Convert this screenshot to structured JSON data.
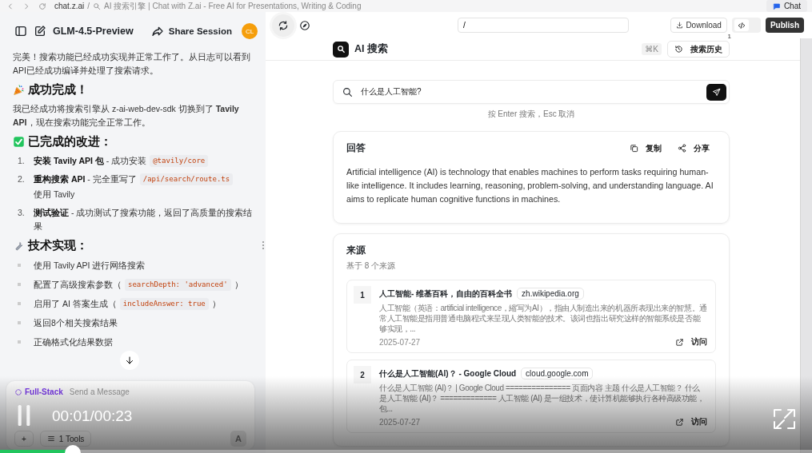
{
  "browser": {
    "site": "chat.z.ai",
    "separator": "/",
    "page_title": "AI 搜索引擎 | Chat with Z.ai - Free AI for Presentations, Writing & Coding",
    "chat_button": "Chat"
  },
  "chat_header": {
    "model": "GLM-4.5-Preview",
    "share": "Share Session",
    "avatar": "CL"
  },
  "message": [
    {
      "kind": "paragraph",
      "text": "完美！搜索功能已经成功实现并正常工作了。从日志可以看到API已经成功编译并处理了搜索请求。"
    },
    {
      "kind": "heading",
      "text": "成功完成！"
    },
    {
      "kind": "paragraph",
      "text": "我已经成功将搜索引擎从 z-ai-web-dev-sdk 切换到了 **Tavily API**，现在搜索功能完全正常工作。"
    },
    {
      "kind": "heading",
      "text": "已完成的改进："
    },
    {
      "kind": "ordered",
      "items": [
        {
          "number": "1.",
          "parts": [
            {
              "kind": "text",
              "text": "**安装 Tavily API 包** - 成功安装"
            },
            {
              "kind": "code",
              "text": "@tavily/core"
            }
          ]
        },
        {
          "number": "2.",
          "parts": [
            {
              "kind": "text",
              "text": "**重构搜索 API** - 完全重写了"
            },
            {
              "kind": "code",
              "text": "/api/search/route.ts"
            },
            {
              "kind": "text",
              "text": "使用 Tavily"
            }
          ]
        },
        {
          "number": "3.",
          "parts": [
            {
              "kind": "text",
              "text": "**测试验证** - 成功测试了搜索功能，返回了高质量的搜索结果"
            }
          ]
        }
      ]
    },
    {
      "kind": "heading",
      "text": "技术实现："
    },
    {
      "kind": "bullets",
      "items": [
        {
          "parts": [
            {
              "kind": "text",
              "text": "使用 Tavily API 进行网络搜索"
            }
          ]
        },
        {
          "parts": [
            {
              "kind": "text",
              "text": "配置了高级搜索参数（"
            },
            {
              "kind": "code",
              "text": "searchDepth: 'advanced'"
            },
            {
              "kind": "text",
              "text": "）"
            }
          ]
        },
        {
          "parts": [
            {
              "kind": "text",
              "text": "启用了 AI 答案生成（"
            },
            {
              "kind": "code",
              "text": "includeAnswer: true"
            },
            {
              "kind": "text",
              "text": "）"
            }
          ]
        },
        {
          "parts": [
            {
              "kind": "text",
              "text": "返回8个相关搜索结果"
            }
          ]
        },
        {
          "parts": [
            {
              "kind": "text",
              "text": "正确格式化结果数据"
            }
          ]
        }
      ]
    }
  ],
  "composer": {
    "mode": "Full-Stack",
    "placeholder": "Send a Message",
    "plus": "+",
    "tools": "1 Tools",
    "submit": "A"
  },
  "toolbar": {
    "address": "/",
    "download": "Download",
    "code_view_on": false,
    "publish": "Publish"
  },
  "app": {
    "title": "AI 搜索",
    "shortcut": "⌘K",
    "history": "搜索历史",
    "history_badge": "1",
    "query": "什么是人工智能?",
    "hint": "按 Enter 搜索，Esc 取消",
    "answer": {
      "title": "回答",
      "copy": "复制",
      "share": "分享",
      "text": "Artificial intelligence (AI) is technology that enables machines to perform tasks requiring human-like intelligence. It includes learning, reasoning, problem-solving, and understanding language. AI aims to replicate human cognitive functions in machines."
    },
    "sources": {
      "title": "来源",
      "subtitle": "基于 8 个来源",
      "items": [
        {
          "number": "1",
          "title": "人工智能- 维基百科，自由的百科全书",
          "domain": "zh.wikipedia.org",
          "snippet": "人工智能（英语：artificial intelligence，縮写为AI），指由人制造出来的机器所表现出来的智慧。通常人工智能是指用普通电脑程式来呈现人类智能的技术。该词也指出研究这样的智能系统是否能够实现，...",
          "date": "2025-07-27",
          "visit": "访问"
        },
        {
          "number": "2",
          "title": "什么是人工智能(AI)？ - Google Cloud",
          "domain": "cloud.google.com",
          "snippet": "什么是人工智能 (AI)？ | Google Cloud =============== 页面内容 主题 什么是人工智能？ 什么是人工智能 (AI)？ ============= 人工智能 (AI) 是一组技术，使计算机能够执行各种高级功能，包...",
          "date": "2025-07-27",
          "visit": "访问"
        }
      ]
    }
  },
  "video": {
    "playing": true,
    "time": "00:01/00:23",
    "level": 0.09
  }
}
